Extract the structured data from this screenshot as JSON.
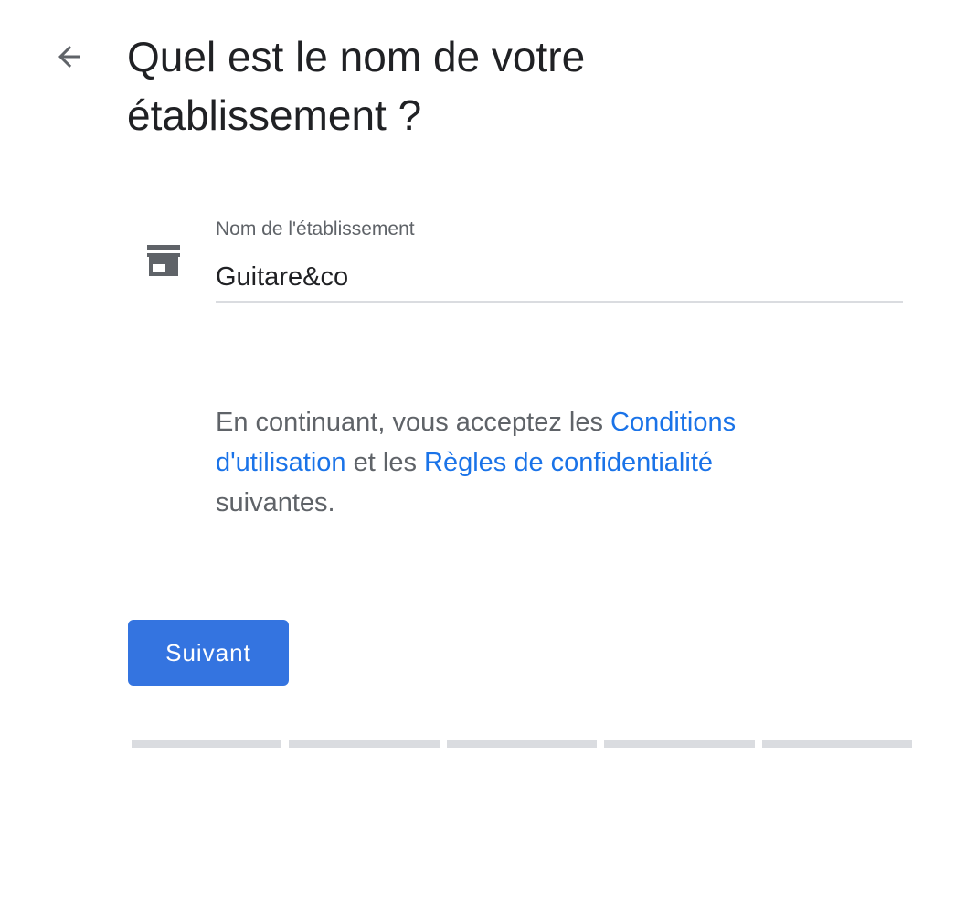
{
  "header": {
    "back_icon": "arrow-back-icon",
    "title_line1": "Quel est le nom de votre",
    "title_line2": "établissement ?"
  },
  "form": {
    "field_icon": "store-icon",
    "field_label": "Nom de l'établissement",
    "field_value": "Guitare&co"
  },
  "terms": {
    "text_before": "En continuant, vous acceptez les ",
    "link_conditions_line1": "Conditions",
    "link_conditions_line2": "d'utilisation",
    "text_middle": " et les ",
    "link_privacy": "Règles de confidentialité",
    "text_after": "suivantes."
  },
  "actions": {
    "next_label": "Suivant"
  },
  "progress": {
    "total_steps": 5,
    "completed_steps": 0
  },
  "colors": {
    "primary": "#3474e0",
    "link": "#1a73e8",
    "text": "#202124",
    "muted": "#5f6368",
    "progress_track": "#dadce0"
  }
}
